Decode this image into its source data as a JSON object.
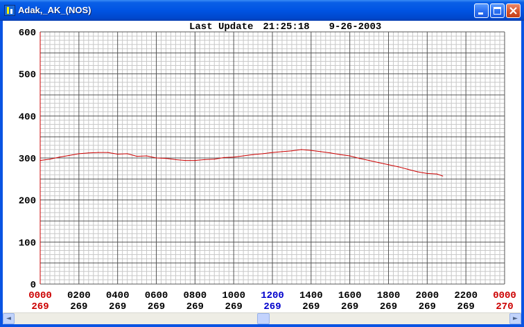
{
  "window": {
    "title": "Adak,_AK_(NOS)",
    "controls": [
      "minimize",
      "maximize",
      "close"
    ]
  },
  "header": {
    "label": "Last Update",
    "time": "21:25:18",
    "date": "9-26-2003"
  },
  "chart_data": {
    "type": "line",
    "title": "Last Update  21:25:18   9-26-2003",
    "xlabel": "",
    "ylabel": "",
    "ylim": [
      0,
      600
    ],
    "y_ticks": [
      "600",
      "500",
      "400",
      "300",
      "200",
      "100",
      "0"
    ],
    "x_ticks": [
      {
        "time": "0000",
        "day": "269",
        "color": "#cc0000"
      },
      {
        "time": "0200",
        "day": "269",
        "color": "#000000"
      },
      {
        "time": "0400",
        "day": "269",
        "color": "#000000"
      },
      {
        "time": "0600",
        "day": "269",
        "color": "#000000"
      },
      {
        "time": "0800",
        "day": "269",
        "color": "#000000"
      },
      {
        "time": "1000",
        "day": "269",
        "color": "#000000"
      },
      {
        "time": "1200",
        "day": "269",
        "color": "#0000cc"
      },
      {
        "time": "1400",
        "day": "269",
        "color": "#000000"
      },
      {
        "time": "1600",
        "day": "269",
        "color": "#000000"
      },
      {
        "time": "1800",
        "day": "269",
        "color": "#000000"
      },
      {
        "time": "2000",
        "day": "269",
        "color": "#000000"
      },
      {
        "time": "2200",
        "day": "269",
        "color": "#000000"
      },
      {
        "time": "0000",
        "day": "270",
        "color": "#cc0000"
      }
    ],
    "x_range_hours": [
      0,
      24
    ],
    "grid": true,
    "series": [
      {
        "color": "#cc0000",
        "x_hours": [
          0,
          0.5,
          1,
          1.5,
          2,
          2.5,
          3,
          3.5,
          4,
          4.5,
          5,
          5.5,
          6,
          6.5,
          7,
          7.5,
          8,
          8.5,
          9,
          9.5,
          10,
          10.5,
          11,
          11.5,
          12,
          12.5,
          13,
          13.5,
          14,
          14.5,
          15,
          15.5,
          16,
          16.5,
          17,
          17.5,
          18,
          18.5,
          19,
          19.5,
          20,
          20.5,
          20.8
        ],
        "values": [
          294,
          297,
          302,
          306,
          310,
          312,
          313,
          313,
          309,
          310,
          304,
          305,
          300,
          299,
          296,
          294,
          294,
          296,
          297,
          301,
          302,
          305,
          308,
          310,
          313,
          315,
          317,
          320,
          318,
          315,
          312,
          308,
          305,
          299,
          294,
          289,
          284,
          279,
          273,
          267,
          263,
          262,
          257
        ]
      }
    ]
  },
  "scrollbar": {
    "left_arrow": "◄",
    "right_arrow": "►"
  }
}
